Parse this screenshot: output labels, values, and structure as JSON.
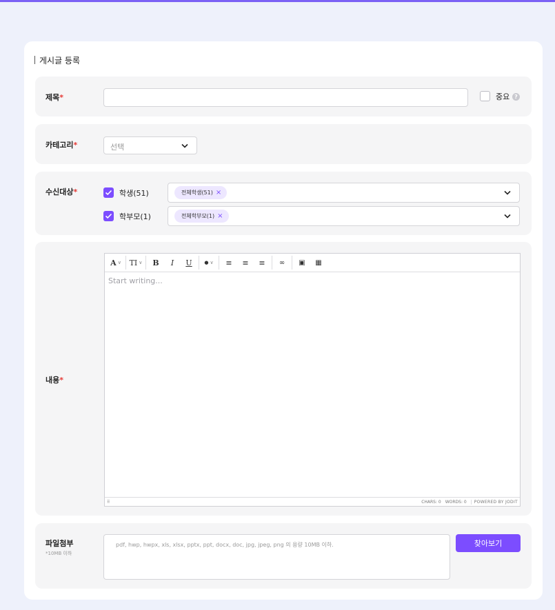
{
  "card": {
    "title": "게시글 등록"
  },
  "title_section": {
    "label": "제목",
    "required_mark": "*",
    "input_value": "",
    "important_label": "중요",
    "important_checked": false,
    "help_glyph": "?"
  },
  "category_section": {
    "label": "카테고리",
    "required_mark": "*",
    "select_placeholder": "선택",
    "icon": "chevron-down-icon"
  },
  "recipients_section": {
    "label": "수신대상",
    "required_mark": "*",
    "rows": [
      {
        "label": "학생(51)",
        "checked": true,
        "tag": "전체학생(51)",
        "tag_remove": "×"
      },
      {
        "label": "학부모(1)",
        "checked": true,
        "tag": "전체학부모(1)",
        "tag_remove": "×"
      }
    ]
  },
  "content_section": {
    "label": "내용",
    "required_mark": "*",
    "editor": {
      "toolbar": [
        {
          "name": "font-color-icon",
          "glyph": "A",
          "dropdown": true
        },
        {
          "name": "font-size-icon",
          "glyph": "TI",
          "dropdown": true
        },
        {
          "name": "bold-icon",
          "glyph": "B"
        },
        {
          "name": "italic-icon",
          "glyph": "I"
        },
        {
          "name": "underline-icon",
          "glyph": "U"
        },
        {
          "name": "brush-icon",
          "glyph": "●",
          "dropdown": true
        },
        {
          "name": "align-left-icon",
          "glyph": "≡"
        },
        {
          "name": "align-center-icon",
          "glyph": "≡"
        },
        {
          "name": "align-right-icon",
          "glyph": "≡"
        },
        {
          "name": "link-icon",
          "glyph": "∞"
        },
        {
          "name": "image-icon",
          "glyph": "▣"
        },
        {
          "name": "table-icon",
          "glyph": "▦"
        }
      ],
      "placeholder": "Start writing...",
      "status_path": "⠿",
      "chars": "CHARS: 0",
      "words": "WORDS: 0",
      "powered": "POWERED BY JODIT"
    }
  },
  "attachment_section": {
    "label": "파일첨부",
    "sublabel": "*10MB 이하",
    "placeholder": "pdf, hwp, hwpx, xls, xlsx, pptx, ppt, docx, doc, jpg, jpeg, png 의 용량 10MB 이하.",
    "browse_label": "찾아보기"
  },
  "colors": {
    "accent": "#7c4dff",
    "topbar": "#7b61f5",
    "background": "#eef1fb",
    "section_bg": "#f5f5f6",
    "tag_bg": "#ede7ff",
    "required": "#e53935"
  }
}
